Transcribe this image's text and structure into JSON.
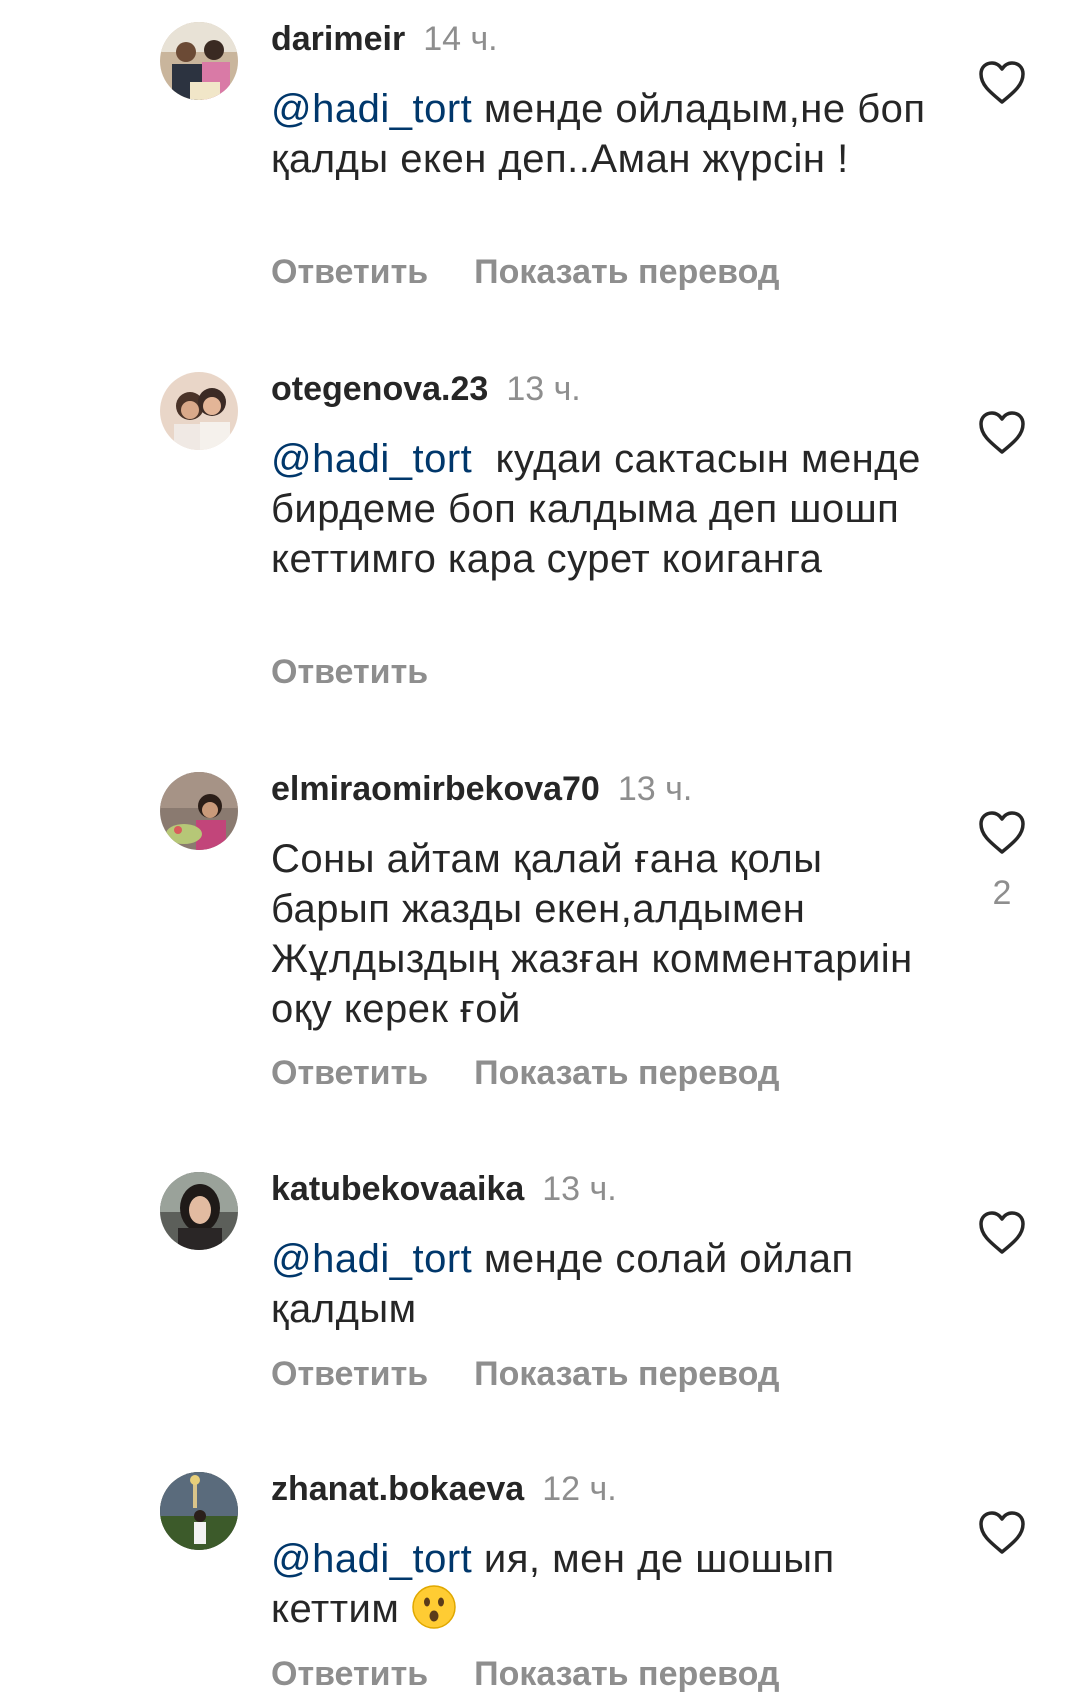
{
  "comments": [
    {
      "username": "darimeir",
      "time": "14 ч.",
      "mention": "@hadi_tort",
      "text": " менде ойладым,не боп қалды екен деп..Аман жүрсін !",
      "reply_label": "Ответить",
      "translate_label": "Показать перевод",
      "likes": ""
    },
    {
      "username": "otegenova.23",
      "time": "13 ч.",
      "mention": "@hadi_tort",
      "text": "  кудаи сактасын менде бирдеме боп калдыма деп шошп кеттимго кара сурет коиганга",
      "reply_label": "Ответить",
      "translate_label": "",
      "likes": ""
    },
    {
      "username": "elmiraomirbekova70",
      "time": "13 ч.",
      "mention": "",
      "text": "Соны айтам қалай ғана қолы барып жазды екен,алдымен Жұлдыздың жазған комментариін оқу керек ғой",
      "reply_label": "Ответить",
      "translate_label": "Показать перевод",
      "likes": "2"
    },
    {
      "username": "katubekovaaika",
      "time": "13 ч.",
      "mention": "@hadi_tort",
      "text": " менде солай ойлап қалдым",
      "reply_label": "Ответить",
      "translate_label": "Показать перевод",
      "likes": ""
    },
    {
      "username": "zhanat.bokaeva",
      "time": "12 ч.",
      "mention": "@hadi_tort",
      "text": " ия, мен де шошып кеттим ",
      "emoji": "hushed-face-emoji",
      "reply_label": "Ответить",
      "translate_label": "Показать перевод",
      "likes": ""
    }
  ],
  "icons": {
    "like": "heart-outline-icon"
  },
  "colors": {
    "text": "#262626",
    "secondary": "#8e8e8e",
    "mention": "#00376b"
  }
}
